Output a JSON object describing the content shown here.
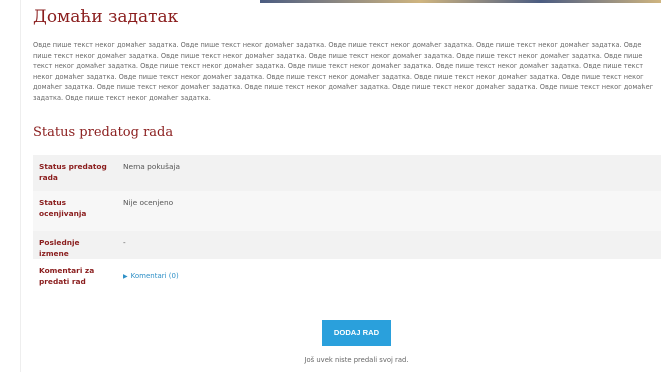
{
  "page": {
    "title": "Домаћи задатак",
    "description": "Овде пише текст неког домаћег задатка. Овде пише текст неког домаћег задатка. Овде пише текст неког домаћег задатка. Овде пише текст неког домаћег задатка. Овде пише текст неког домаћег задатка. Овде пише текст неког домаћег задатка. Овде пише текст неког домаћег задатка. Овде пише текст неког домаћег задатка. Овде пише текст неког домаћег задатка. Овде пише текст неког домаћег задатка. Овде пише текст неког домаћег задатка. Овде пише текст неког домаћег задатка. Овде пише текст неког домаћег задатка. Овде пише текст неког домаћег задатка. Овде пише текст неког домаћег задатка. Овде пише текст неког домаћег задатка. Овде пише текст неког домаћег задатка. Овде пише текст неког домаћег задатка. Овде пише текст неког домаћег задатка. Овде пише текст неког домаћег задатка. Овде пише текст неког домаћег задатка. Овде пише текст неког домаћег задатка."
  },
  "submission_status": {
    "title": "Status predatog rada",
    "rows": [
      {
        "label": "Status predatog rada",
        "value": "Nema pokušaja"
      },
      {
        "label": "Status ocenjivanja",
        "value": "Nije ocenjeno"
      },
      {
        "label": "Poslednje izmene",
        "value": "-"
      },
      {
        "label": "Komentari za predati rad",
        "value": "Komentari (0)"
      }
    ]
  },
  "actions": {
    "submit_label": "DODAJ RAD",
    "submit_note": "Još uvek niste predali svoj rad."
  },
  "colors": {
    "accent": "#8a1d1d",
    "button": "#2aa0dc",
    "link": "#2d8fc6"
  },
  "icons": {
    "comments_toggle": "triangle-right-icon"
  }
}
